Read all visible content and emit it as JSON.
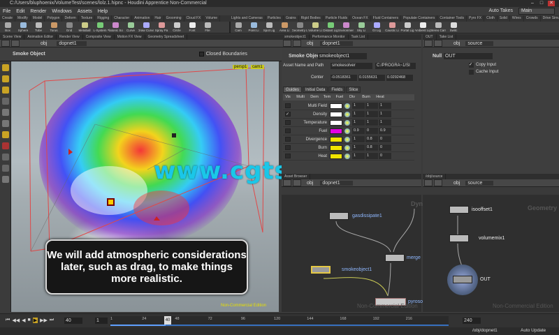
{
  "window": {
    "title": "C:/Users/bluphoenix/VolumeTest/scenes/lolz.1.hipnc - Houdini Apprentice Non-Commercial",
    "min": "–",
    "max": "□",
    "close": "✕"
  },
  "menu": [
    "File",
    "Edit",
    "Render",
    "Windows",
    "Assets",
    "Help"
  ],
  "menu_right": {
    "auto_takes": "Auto Takes",
    "desktop": "Main"
  },
  "shelf_tabs_left": [
    "Create",
    "Modify",
    "Model",
    "Polygon",
    "Deform",
    "Texture",
    "Rigging",
    "Character",
    "Animation",
    "Hair",
    "Grooming",
    "Cloud FX",
    "Volume"
  ],
  "shelf_tabs_right": [
    "Lights and Cameras",
    "Particles",
    "Grains",
    "Rigid Bodies",
    "Particle Fluids",
    "Ocean FX",
    "Fluid Containers",
    "Populate Containers",
    "Container Tools",
    "Pyro FX",
    "Cloth",
    "Solid",
    "Wires",
    "Crowds",
    "Drive Simulation"
  ],
  "shelf_tools_left": [
    "Box",
    "Sphere",
    "Tube",
    "Torus",
    "Grid",
    "Metaball",
    "L-System",
    "Platonic Sol",
    "Curve",
    "Draw Curve",
    "Spray Pa",
    "Circle",
    "Font",
    "File"
  ],
  "shelf_tools_right": [
    "Cam",
    "Point Li",
    "Spot Lig",
    "Area Li",
    "Geometry L",
    "Volume Li",
    "Distant Lig",
    "Environmen",
    "Sky Li",
    "GI Lig",
    "Caustic Li",
    "Portal Lig",
    "Ambient Lig",
    "Stereo Cam",
    "Switc"
  ],
  "left_tabs": [
    "Scene View",
    "Animation Editor",
    "Render View",
    "Composite View",
    "Motion FX View",
    "Geometry Spreadsheet"
  ],
  "viewport": {
    "path": "obj",
    "node": "dopnet1",
    "object": "Smoke Object",
    "closed_boundaries": "Closed Boundaries",
    "persp": "persp1",
    "cam": "cam1",
    "watermark_label": "Non-Commercial Edition"
  },
  "caption": "We will add atmospheric considerations later, such as drag, to make things more realistic.",
  "watermark": "www.cgtsj.com",
  "mid_tabs": [
    "smokeobject1",
    "Performance Monitor",
    "Task List"
  ],
  "params": {
    "path": "obj",
    "node": "dopnet1",
    "type": "Smoke Object",
    "name": "smokeobject1",
    "asset_label": "Asset Name and Path",
    "asset_value": "smokesolver",
    "asset_path": "C:/PROGRA~1/SI",
    "center_label": "Center",
    "center": [
      "-0.0518361",
      "0.0155631",
      "0.0292468"
    ],
    "tabs": [
      "Guides",
      "Initial Data",
      "Fields",
      "Slice"
    ],
    "columns": [
      "Vis",
      "Multi",
      "Dem",
      "Tem",
      "Fuel",
      "Div",
      "Burn",
      "Heat"
    ],
    "rows": [
      {
        "name": "Multi Field",
        "color": "#ffffff",
        "vals": [
          "1",
          "1",
          "1"
        ]
      },
      {
        "name": "Density",
        "color": "#ffffff",
        "vals": [
          "1",
          "1",
          "1"
        ]
      },
      {
        "name": "Temperature",
        "color": "#ffffff",
        "vals": [
          "1",
          "1",
          "1"
        ]
      },
      {
        "name": "Fuel",
        "color": "#e400e4",
        "vals": [
          "0.9",
          "0",
          "0.9"
        ]
      },
      {
        "name": "Divergence",
        "color": "#f0e400",
        "vals": [
          "1",
          "0.8",
          "0"
        ]
      },
      {
        "name": "Burn",
        "color": "#f0e400",
        "vals": [
          "1",
          "0.8",
          "0"
        ]
      },
      {
        "name": "Heat",
        "color": "#f0e400",
        "vals": [
          "1",
          "1",
          "0"
        ]
      }
    ]
  },
  "right_tabs": [
    "OUT",
    "Take List"
  ],
  "null_panel": {
    "path": "obj",
    "node": "source",
    "type": "Null",
    "name": "OUT",
    "copy_input": "Copy Input",
    "cache_input": "Cache Input"
  },
  "net_left": {
    "path": "obj",
    "node": "dopnet1",
    "tab": "Asset Browser",
    "nodes": [
      "gasdissipate1",
      "smokeobject1",
      "merge",
      "pyrosolver1"
    ],
    "watermark": "Non-Commercial Edition",
    "context": "DynamicsNet"
  },
  "net_right": {
    "path": "obj",
    "node": "source",
    "tab": "/obj/source",
    "nodes": [
      "isooffset1",
      "volumemix1",
      "OUT"
    ],
    "watermark": "Non-Commercial Edition",
    "context": "Geometry"
  },
  "timeline": {
    "frame": "40",
    "start": "1",
    "end": "240",
    "ticks": [
      "1",
      "24",
      "48",
      "72",
      "96",
      "120",
      "144",
      "168",
      "192",
      "216"
    ],
    "current": "40",
    "progress": 0.163
  },
  "status": {
    "path": "/obj/dopnet1",
    "auto_update": "Auto Update"
  }
}
